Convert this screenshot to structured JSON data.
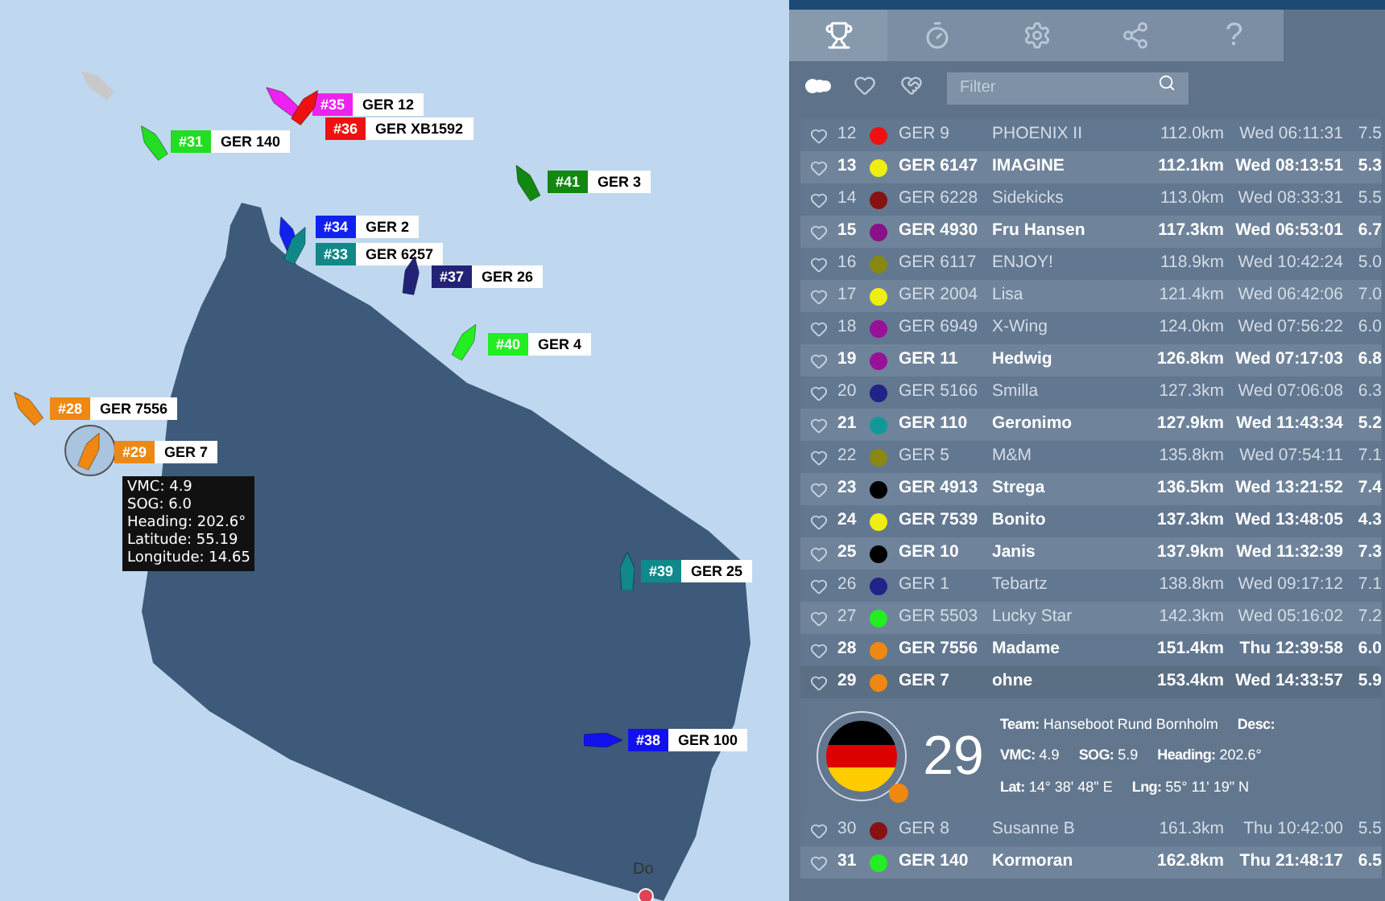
{
  "map": {
    "boats": [
      {
        "number": "#31",
        "sail": "GER 140",
        "color": "#22dd22",
        "selected": false
      },
      {
        "number": "#35",
        "sail": "GER 12",
        "color": "#ee22ee",
        "selected": false
      },
      {
        "number": "#36",
        "sail": "GER XB1592",
        "color": "#ee1111",
        "selected": false
      },
      {
        "number": "#41",
        "sail": "GER 3",
        "color": "#118811",
        "selected": false
      },
      {
        "number": "#34",
        "sail": "GER 2",
        "color": "#1122ee",
        "selected": false
      },
      {
        "number": "#33",
        "sail": "GER 6257",
        "color": "#118888",
        "selected": false
      },
      {
        "number": "#37",
        "sail": "GER 26",
        "color": "#222277",
        "selected": false
      },
      {
        "number": "#40",
        "sail": "GER 4",
        "color": "#22ee22",
        "selected": false
      },
      {
        "number": "#28",
        "sail": "GER 7556",
        "color": "#ee8811",
        "selected": false
      },
      {
        "number": "#29",
        "sail": "GER 7",
        "color": "#ee8812",
        "selected": true
      },
      {
        "number": "#39",
        "sail": "GER 25",
        "color": "#118889",
        "selected": false
      },
      {
        "number": "#38",
        "sail": "GER 100",
        "color": "#1111ef",
        "selected": false
      }
    ],
    "tooltip": [
      "VMC: 4.9",
      "SOG: 6.0",
      "Heading: 202.6°",
      "Latitude: 55.19",
      "Longitude: 14.65"
    ],
    "place_label": "Do"
  },
  "tabs": [
    {
      "kind": "trophy",
      "selected": true
    },
    {
      "kind": "stopwatch",
      "selected": false
    },
    {
      "kind": "settings",
      "selected": false
    },
    {
      "kind": "share",
      "selected": false
    },
    {
      "kind": "text",
      "label": "?",
      "selected": false
    }
  ],
  "filter": {
    "placeholder": "Filter"
  },
  "rows": [
    {
      "rank": "12",
      "color": "#ee1111",
      "sail": "GER 9",
      "name": "PHOENIX II",
      "distance": "112.0km",
      "time": "Wed 06:11:31",
      "speed": "7.5",
      "faded": true,
      "selected": false
    },
    {
      "rank": "13",
      "color": "#eeee11",
      "sail": "GER 6147",
      "name": "IMAGINE",
      "distance": "112.1km",
      "time": "Wed 08:13:51",
      "speed": "5.3",
      "faded": false,
      "selected": false
    },
    {
      "rank": "14",
      "color": "#881111",
      "sail": "GER 6228",
      "name": "Sidekicks",
      "distance": "113.0km",
      "time": "Wed 08:33:31",
      "speed": "5.5",
      "faded": true,
      "selected": false
    },
    {
      "rank": "15",
      "color": "#881188",
      "sail": "GER 4930",
      "name": "Fru Hansen",
      "distance": "117.3km",
      "time": "Wed 06:53:01",
      "speed": "6.7",
      "faded": false,
      "selected": false
    },
    {
      "rank": "16",
      "color": "#888811",
      "sail": "GER 6117",
      "name": "ENJOY!",
      "distance": "118.9km",
      "time": "Wed 10:42:24",
      "speed": "5.0",
      "faded": true,
      "selected": false
    },
    {
      "rank": "17",
      "color": "#eeee12",
      "sail": "GER 2004",
      "name": "Lisa",
      "distance": "121.4km",
      "time": "Wed 06:42:06",
      "speed": "7.0",
      "faded": true,
      "selected": false
    },
    {
      "rank": "18",
      "color": "#991199",
      "sail": "GER 6949",
      "name": "X-Wing",
      "distance": "124.0km",
      "time": "Wed 07:56:22",
      "speed": "6.0",
      "faded": true,
      "selected": false
    },
    {
      "rank": "19",
      "color": "#991198",
      "sail": "GER 11",
      "name": "Hedwig",
      "distance": "126.8km",
      "time": "Wed 07:17:03",
      "speed": "6.8",
      "faded": false,
      "selected": false
    },
    {
      "rank": "20",
      "color": "#222288",
      "sail": "GER 5166",
      "name": "Smilla",
      "distance": "127.3km",
      "time": "Wed 07:06:08",
      "speed": "6.3",
      "faded": true,
      "selected": false
    },
    {
      "rank": "21",
      "color": "#119999",
      "sail": "GER 110",
      "name": "Geronimo",
      "distance": "127.9km",
      "time": "Wed 11:43:34",
      "speed": "5.2",
      "faded": false,
      "selected": false
    },
    {
      "rank": "22",
      "color": "#888812",
      "sail": "GER 5",
      "name": "M&M",
      "distance": "135.8km",
      "time": "Wed 07:54:11",
      "speed": "7.1",
      "faded": true,
      "selected": false
    },
    {
      "rank": "23",
      "color": "#000000",
      "sail": "GER 4913",
      "name": "Strega",
      "distance": "136.5km",
      "time": "Wed 13:21:52",
      "speed": "7.4",
      "faded": false,
      "selected": false
    },
    {
      "rank": "24",
      "color": "#eeee13",
      "sail": "GER 7539",
      "name": "Bonito",
      "distance": "137.3km",
      "time": "Wed 13:48:05",
      "speed": "4.3",
      "faded": false,
      "selected": false
    },
    {
      "rank": "25",
      "color": "#000001",
      "sail": "GER 10",
      "name": "Janis",
      "distance": "137.9km",
      "time": "Wed 11:32:39",
      "speed": "7.3",
      "faded": false,
      "selected": false
    },
    {
      "rank": "26",
      "color": "#222289",
      "sail": "GER 1",
      "name": "Tebartz",
      "distance": "138.8km",
      "time": "Wed 09:17:12",
      "speed": "7.1",
      "faded": true,
      "selected": false
    },
    {
      "rank": "27",
      "color": "#22ee22",
      "sail": "GER 5503",
      "name": "Lucky Star",
      "distance": "142.3km",
      "time": "Wed 05:16:02",
      "speed": "7.2",
      "faded": true,
      "selected": false
    },
    {
      "rank": "28",
      "color": "#ee8811",
      "sail": "GER 7556",
      "name": "Madame",
      "distance": "151.4km",
      "time": "Thu 12:39:58",
      "speed": "6.0",
      "faded": false,
      "selected": false
    },
    {
      "rank": "29",
      "color": "#ee8812",
      "sail": "GER 7",
      "name": "ohne",
      "distance": "153.4km",
      "time": "Wed 14:33:57",
      "speed": "5.9",
      "faded": false,
      "selected": true
    },
    {
      "rank": "30",
      "color": "#881112",
      "sail": "GER 8",
      "name": "Susanne B",
      "distance": "161.3km",
      "time": "Thu 10:42:00",
      "speed": "5.5",
      "faded": true,
      "selected": false
    },
    {
      "rank": "31",
      "color": "#22ee23",
      "sail": "GER 140",
      "name": "Kormoran",
      "distance": "162.8km",
      "time": "Thu 21:48:17",
      "speed": "6.5",
      "faded": false,
      "selected": false
    }
  ],
  "details": {
    "rank": "29",
    "lines": [
      [
        {
          "label": "Team:",
          "value": "Hanseboot Rund Bornholm"
        },
        {
          "label": "Desc:"
        }
      ],
      [
        {
          "label": "VMC:",
          "value": "4.9"
        },
        {
          "label": "SOG:",
          "value": "5.9"
        },
        {
          "label": "Heading:",
          "value": "202.6°"
        }
      ],
      [
        {
          "label": "Lat:",
          "value": "14° 38' 48\" E"
        },
        {
          "label": "Lng:",
          "value": "55° 11' 19\" N"
        }
      ]
    ]
  }
}
